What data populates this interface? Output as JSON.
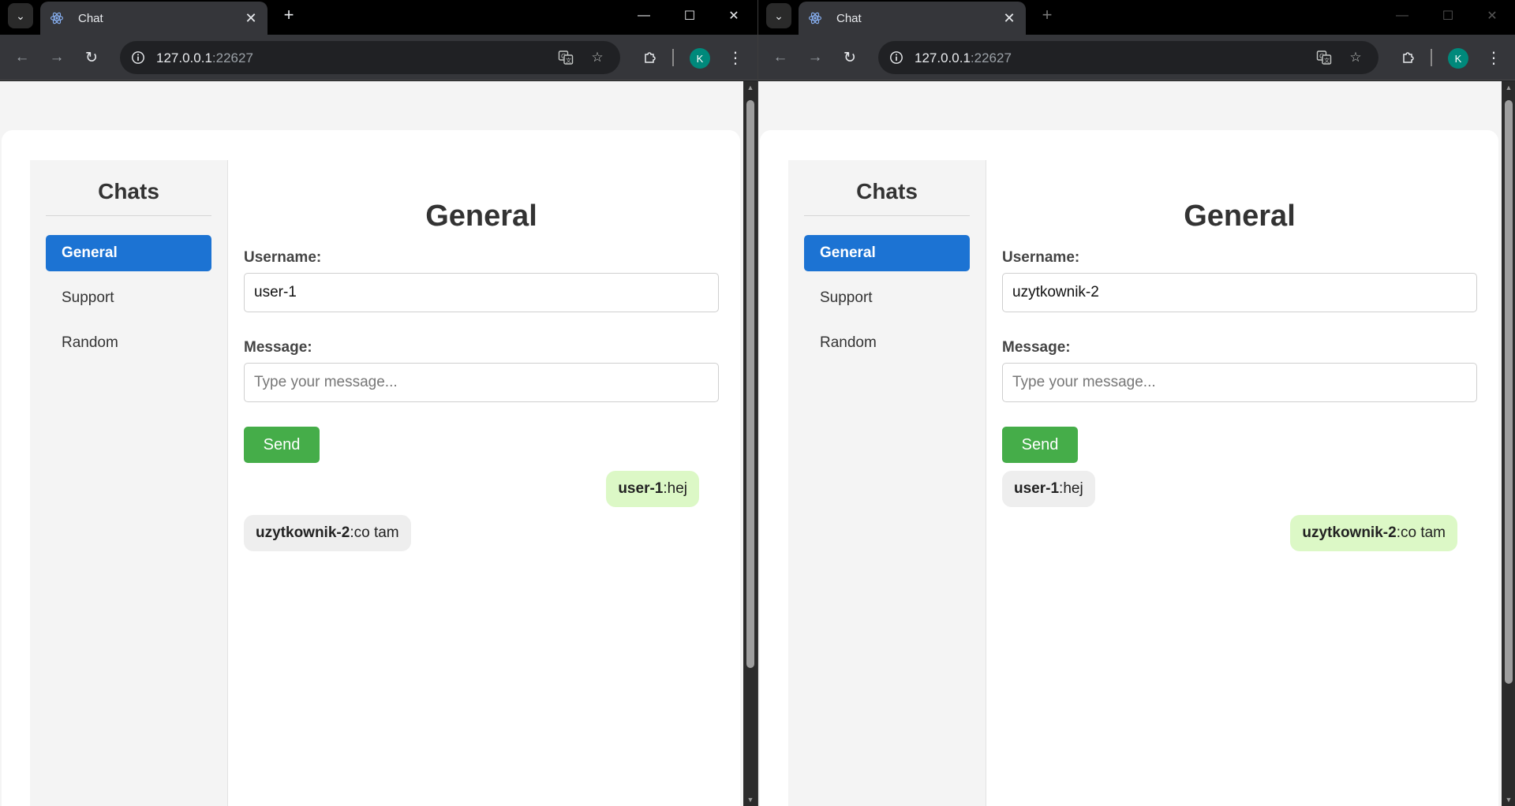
{
  "browser_left": {
    "tab_title": "Chat",
    "url_host": "127.0.0.1",
    "url_port": ":22627",
    "profile_initial": "K"
  },
  "browser_right": {
    "tab_title": "Chat",
    "url_host": "127.0.0.1",
    "url_port": ":22627",
    "profile_initial": "K"
  },
  "app_left": {
    "sidebar_title": "Chats",
    "rooms": [
      {
        "label": "General",
        "active": true
      },
      {
        "label": "Support",
        "active": false
      },
      {
        "label": "Random",
        "active": false
      }
    ],
    "room_title": "General",
    "username_label": "Username:",
    "username_value": "user-1",
    "message_label": "Message:",
    "message_placeholder": "Type your message...",
    "send_label": "Send",
    "messages": [
      {
        "user": "user-1",
        "sep": ": ",
        "text": "hej",
        "own": true
      },
      {
        "user": "uzytkownik-2",
        "sep": ": ",
        "text": "co tam",
        "own": false
      }
    ]
  },
  "app_right": {
    "sidebar_title": "Chats",
    "rooms": [
      {
        "label": "General",
        "active": true
      },
      {
        "label": "Support",
        "active": false
      },
      {
        "label": "Random",
        "active": false
      }
    ],
    "room_title": "General",
    "username_label": "Username:",
    "username_value": "uzytkownik-2",
    "message_label": "Message:",
    "message_placeholder": "Type your message...",
    "send_label": "Send",
    "messages": [
      {
        "user": "user-1",
        "sep": ": ",
        "text": "hej",
        "own": false
      },
      {
        "user": "uzytkownik-2",
        "sep": ": ",
        "text": "co tam",
        "own": true
      }
    ]
  },
  "colors": {
    "active_room": "#1c73d3",
    "send_button": "#45ad49",
    "own_bubble": "#dcf8c6",
    "other_bubble": "#eeeeee",
    "profile_avatar": "#00897b"
  }
}
